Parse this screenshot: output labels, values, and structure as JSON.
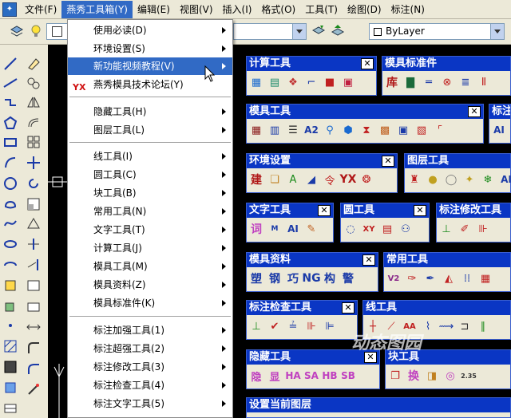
{
  "menubar": {
    "items": [
      "文件(F)",
      "燕秀工具箱(Y)",
      "编辑(E)",
      "视图(V)",
      "插入(I)",
      "格式(O)",
      "工具(T)",
      "绘图(D)",
      "标注(N)"
    ]
  },
  "toolbar": {
    "layer_combo": "ByLayer"
  },
  "dropdown": {
    "items": [
      {
        "label": "使用必读(D)",
        "arrow": true
      },
      {
        "label": "环境设置(S)",
        "arrow": true
      },
      {
        "label": "新功能视频教程(V)",
        "arrow": true
      },
      {
        "label": "燕秀模具技术论坛(Y)",
        "arrow": false,
        "icon": "YX"
      },
      {
        "label": "隐藏工具(H)",
        "arrow": true
      },
      {
        "label": "图层工具(L)",
        "arrow": true
      },
      {
        "label": "线工具(I)",
        "arrow": true
      },
      {
        "label": "圆工具(C)",
        "arrow": true
      },
      {
        "label": "块工具(B)",
        "arrow": true
      },
      {
        "label": "常用工具(N)",
        "arrow": true
      },
      {
        "label": "文字工具(T)",
        "arrow": true
      },
      {
        "label": "计算工具(J)",
        "arrow": true
      },
      {
        "label": "模具工具(M)",
        "arrow": true
      },
      {
        "label": "模具资料(Z)",
        "arrow": true
      },
      {
        "label": "模具标准件(K)",
        "arrow": true
      },
      {
        "label": "标注加强工具(1)",
        "arrow": true
      },
      {
        "label": "标注超强工具(2)",
        "arrow": true
      },
      {
        "label": "标注修改工具(3)",
        "arrow": true
      },
      {
        "label": "标注检查工具(4)",
        "arrow": true
      },
      {
        "label": "标注文字工具(5)",
        "arrow": true
      }
    ]
  },
  "panels": {
    "calc": {
      "title": "计算工具"
    },
    "std": {
      "title": "模具标准件",
      "texts": [
        "库"
      ]
    },
    "mold": {
      "title": "模具工具"
    },
    "mark": {
      "title": "标注"
    },
    "env": {
      "title": "环境设置",
      "texts": [
        "建",
        "YX"
      ]
    },
    "layer": {
      "title": "图层工具"
    },
    "text": {
      "title": "文字工具",
      "texts": [
        "词",
        "AI"
      ]
    },
    "circle": {
      "title": "圆工具"
    },
    "dimmod": {
      "title": "标注修改工具"
    },
    "data": {
      "title": "模具资料",
      "texts": [
        "塑",
        "钢",
        "巧",
        "NG",
        "构",
        "警"
      ]
    },
    "common": {
      "title": "常用工具"
    },
    "dimchk": {
      "title": "标注检查工具"
    },
    "line": {
      "title": "线工具"
    },
    "hide": {
      "title": "隐藏工具",
      "texts": [
        "隐",
        "显",
        "HA",
        "SA",
        "HB",
        "SB"
      ]
    },
    "block": {
      "title": "块工具",
      "texts": [
        "换"
      ]
    },
    "curlayer": {
      "title": "设置当前图层"
    }
  },
  "watermark": "动态图园"
}
